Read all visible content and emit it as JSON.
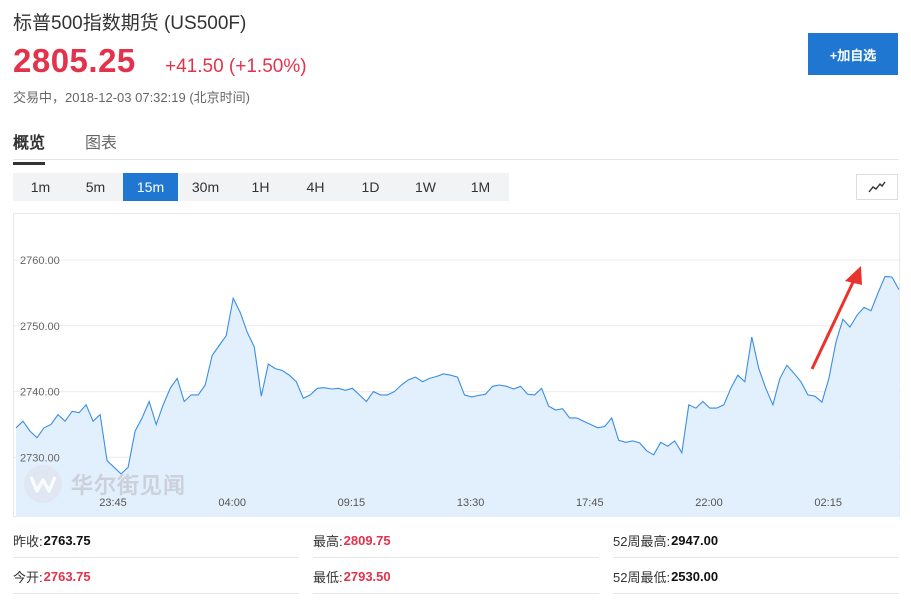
{
  "header": {
    "title": "标普500指数期货  (US500F)",
    "price": "2805.25",
    "change": "+41.50 (+1.50%)",
    "status": "交易中，2018-12-03 07:32:19 (北京时间)",
    "add_button": "+加自选"
  },
  "tabs": [
    {
      "label": "概览",
      "active": true
    },
    {
      "label": "图表",
      "active": false
    }
  ],
  "intervals": [
    {
      "label": "1m",
      "active": false
    },
    {
      "label": "5m",
      "active": false
    },
    {
      "label": "15m",
      "active": true
    },
    {
      "label": "30m",
      "active": false
    },
    {
      "label": "1H",
      "active": false
    },
    {
      "label": "4H",
      "active": false
    },
    {
      "label": "1D",
      "active": false
    },
    {
      "label": "1W",
      "active": false
    },
    {
      "label": "1M",
      "active": false
    }
  ],
  "watermark": {
    "text": "华尔街见闻"
  },
  "colors": {
    "line": "#3a8ee6",
    "fill": "#e2effc",
    "accent": "#1f77d2",
    "up": "#e3324b",
    "annotation_arrow": "#e8342c"
  },
  "chart_data": {
    "type": "area",
    "y_ticks": [
      "2730.00",
      "2740.00",
      "2750.00",
      "2760.00"
    ],
    "x_ticks": [
      "23:45",
      "04:00",
      "09:15",
      "13:30",
      "17:45",
      "22:00",
      "02:15"
    ],
    "ylim": [
      2726.5,
      2766
    ],
    "grid": true,
    "values": [
      2734.5,
      2735.5,
      2734,
      2733,
      2734.5,
      2735,
      2736.5,
      2735.5,
      2737,
      2736.8,
      2738,
      2735.5,
      2736.5,
      2729.5,
      2728.5,
      2727.5,
      2728.5,
      2734,
      2736,
      2738.5,
      2735,
      2738,
      2740.5,
      2742,
      2738.5,
      2739.5,
      2739.5,
      2741,
      2745.5,
      2747,
      2748.5,
      2754.2,
      2752,
      2749,
      2746.8,
      2739.3,
      2744.2,
      2743.5,
      2743.2,
      2742.5,
      2741.5,
      2739,
      2739.5,
      2740.5,
      2740.6,
      2740.4,
      2740.5,
      2740.2,
      2740.5,
      2739.5,
      2738.5,
      2740,
      2739.5,
      2739.5,
      2740,
      2741,
      2741.8,
      2742.2,
      2741.5,
      2742,
      2742.3,
      2742.7,
      2742.5,
      2742.2,
      2739.5,
      2739.2,
      2739.4,
      2739.6,
      2740.8,
      2741,
      2740.8,
      2740.4,
      2740.8,
      2739.6,
      2739.5,
      2740.5,
      2737.8,
      2737.2,
      2737.4,
      2736,
      2736,
      2735.5,
      2735,
      2734.5,
      2734.7,
      2736,
      2732.6,
      2732.3,
      2732.5,
      2732.2,
      2731,
      2730.4,
      2732.3,
      2731.7,
      2732.5,
      2730.7,
      2738,
      2737.5,
      2738.5,
      2737.5,
      2737.5,
      2738,
      2740.5,
      2742.5,
      2741.5,
      2748.3,
      2743.5,
      2740.5,
      2738,
      2742,
      2744,
      2742.8,
      2741.5,
      2739.5,
      2739.3,
      2738.4,
      2742,
      2747.5,
      2751,
      2749.8,
      2751.6,
      2752.8,
      2752.3,
      2755,
      2757.5,
      2757.4,
      2755.5
    ]
  },
  "stats": [
    [
      {
        "label": "昨收:",
        "value": "2763.75",
        "tone": "dark"
      },
      {
        "label": "最高:",
        "value": "2809.75",
        "tone": "red"
      },
      {
        "label": "52周最高:",
        "value": "2947.00",
        "tone": "dark"
      }
    ],
    [
      {
        "label": "今开:",
        "value": "2763.75",
        "tone": "red"
      },
      {
        "label": "最低:",
        "value": "2793.50",
        "tone": "red"
      },
      {
        "label": "52周最低:",
        "value": "2530.00",
        "tone": "dark"
      }
    ]
  ]
}
